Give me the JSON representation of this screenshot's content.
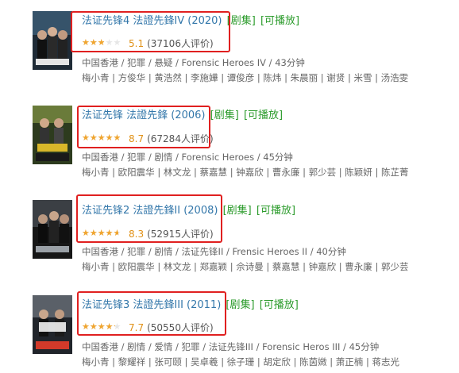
{
  "tags": {
    "series": "[剧集]",
    "playable": "[可播放]"
  },
  "items": [
    {
      "title": "法证先锋4 法證先鋒IV (2020)",
      "rating": 5.1,
      "score": "5.1",
      "votes": "(37106人评价)",
      "info": "中国香港 / 犯罪 / 悬疑 / Forensic Heroes IV / 43分钟",
      "cast": "梅小青 | 方俊华 | 黄浩然 | 李施嬅 | 谭俊彦 | 陈炜 | 朱晨丽 | 谢贤 | 米雪 | 汤浩雯"
    },
    {
      "title": "法证先锋 法證先鋒 (2006)",
      "rating": 8.7,
      "score": "8.7",
      "votes": "(67284人评价)",
      "info": "中国香港 / 犯罪 / 剧情 / Forensic Heroes / 45分钟",
      "cast": "梅小青 | 欧阳震华 | 林文龙 | 蔡嘉慧 | 钟嘉欣 | 曹永廉 | 郭少芸 | 陈颖妍 | 陈芷菁"
    },
    {
      "title": "法证先锋2 法證先鋒II (2008)",
      "rating": 8.3,
      "score": "8.3",
      "votes": "(52915人评价)",
      "info": "中国香港 / 犯罪 / 剧情 / 法证先锋II / Frensic Heroes II / 40分钟",
      "cast": "梅小青 | 欧阳震华 | 林文龙 | 郑嘉颖 | 佘诗曼 | 蔡嘉慧 | 钟嘉欣 | 曹永廉 | 郭少芸"
    },
    {
      "title": "法证先锋3 法證先鋒III (2011)",
      "rating": 7.7,
      "score": "7.7",
      "votes": "(50550人评价)",
      "info": "中国香港 / 剧情 / 爱情 / 犯罪 / 法证先锋III / Forensic Heros III / 45分钟",
      "cast": "梅小青 | 黎耀祥 | 张可颐 | 吴卓羲 | 徐子珊 | 胡定欣 | 陈茵媺 | 萧正楠 | 蒋志光"
    }
  ]
}
